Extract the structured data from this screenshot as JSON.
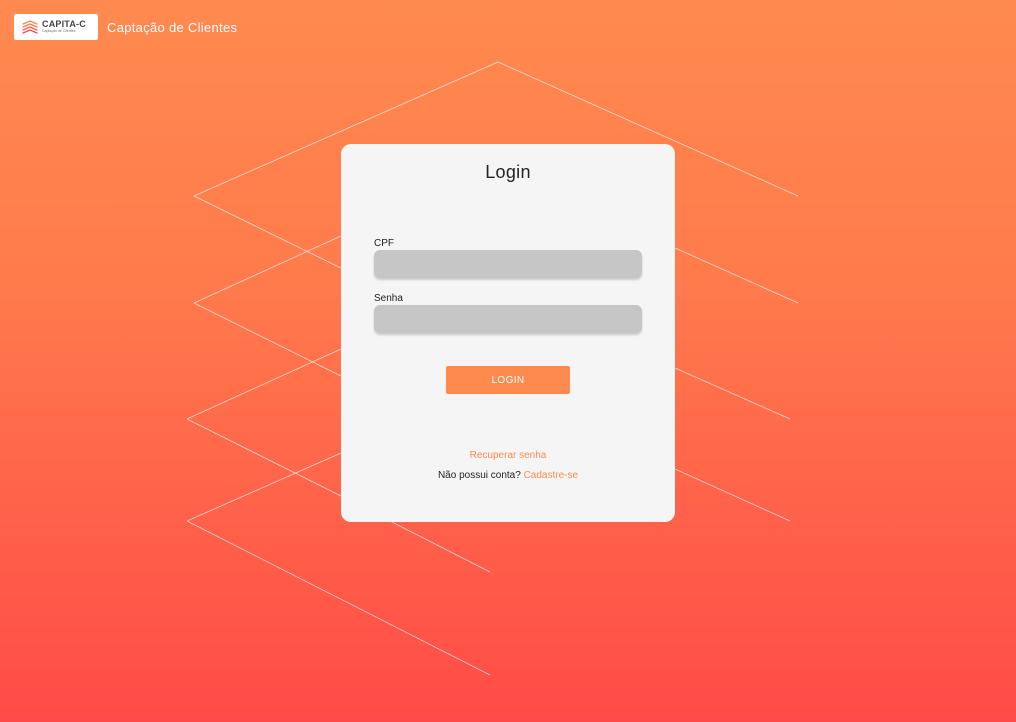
{
  "header": {
    "brand_name": "CAPITA-C",
    "brand_tagline": "Captação de Clientes",
    "app_title": "Captação de Clientes"
  },
  "login_card": {
    "title": "Login",
    "cpf_label": "CPF",
    "cpf_value": "",
    "password_label": "Senha",
    "password_value": "",
    "login_button_label": "LOGIN",
    "recover_password_label": "Recuperar senha",
    "no_account_text": "Não possui conta?",
    "signup_link_label": "Cadastre-se"
  },
  "colors": {
    "accent": "#ff8a50",
    "background_top": "#ff8a4f",
    "background_bottom": "#ff4b48",
    "card_background": "#f5f5f5",
    "input_background": "#c6c6c6"
  },
  "icons": {
    "brand": "layered-stack-logo-icon"
  }
}
